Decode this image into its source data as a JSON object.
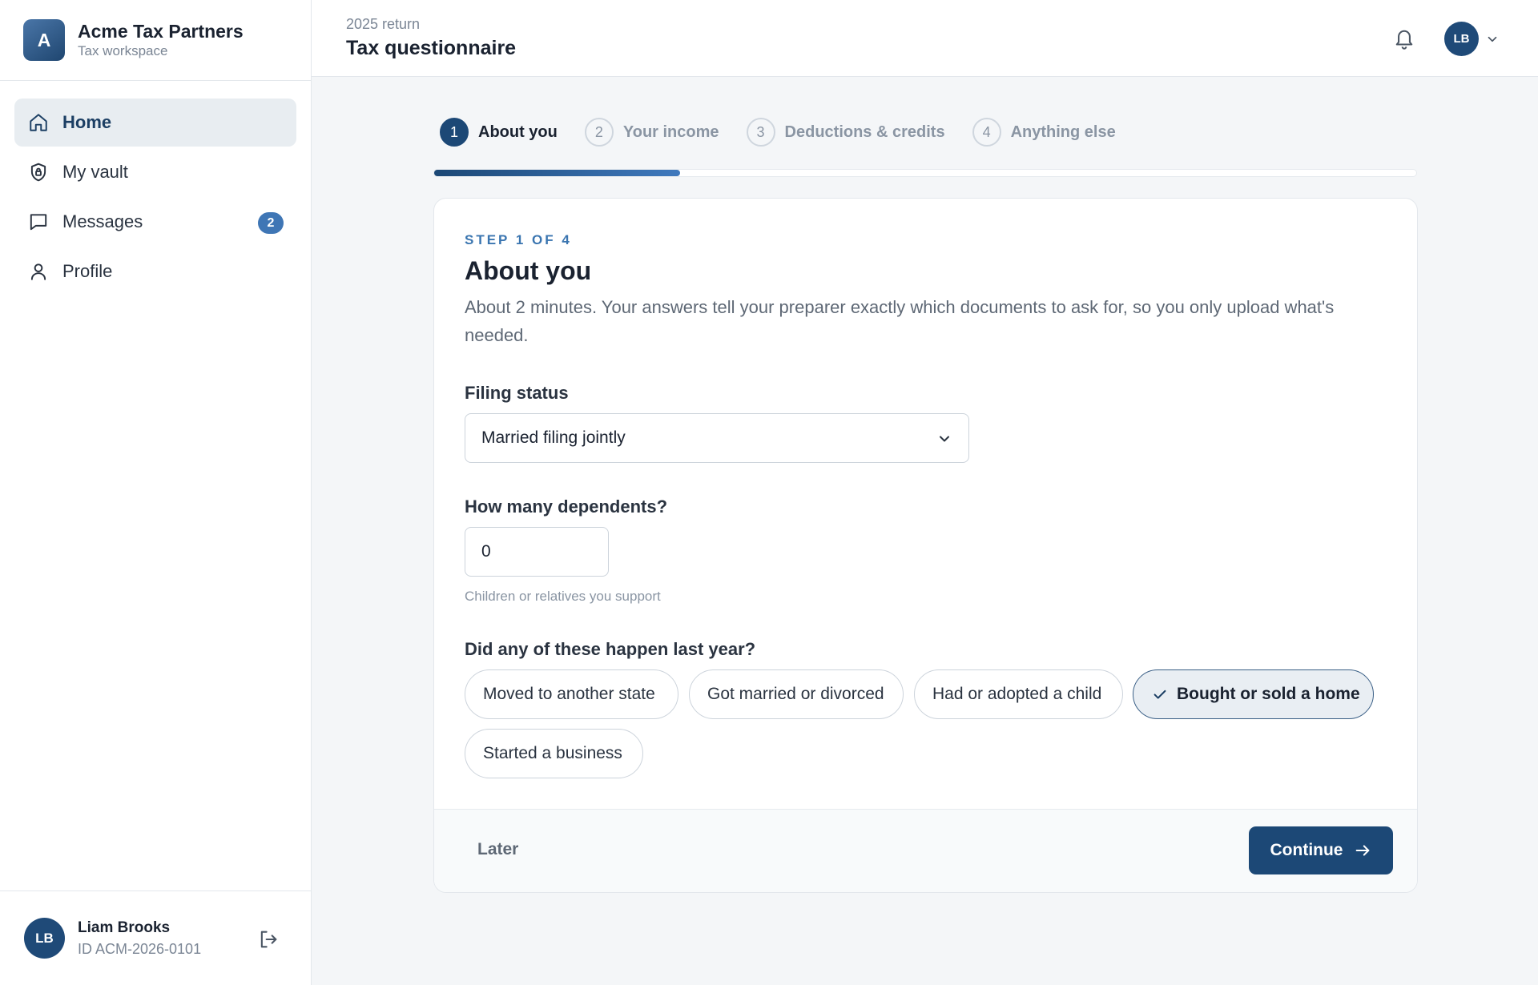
{
  "brand": {
    "logo_letter": "A",
    "name": "Acme Tax Partners",
    "subtitle": "Tax workspace"
  },
  "sidebar": {
    "items": [
      {
        "label": "Home",
        "icon": "home-icon",
        "active": true
      },
      {
        "label": "My vault",
        "icon": "shield-icon"
      },
      {
        "label": "Messages",
        "icon": "chat-icon",
        "badge": "2"
      },
      {
        "label": "Profile",
        "icon": "user-icon"
      }
    ]
  },
  "user": {
    "initials": "LB",
    "name": "Liam Brooks",
    "id": "ID ACM-2026-0101"
  },
  "header": {
    "subtitle": "2025 return",
    "title": "Tax questionnaire",
    "avatar_initials": "LB"
  },
  "stepper": {
    "steps": [
      {
        "number": "1",
        "label": "About you",
        "active": true
      },
      {
        "number": "2",
        "label": "Your income"
      },
      {
        "number": "3",
        "label": "Deductions & credits"
      },
      {
        "number": "4",
        "label": "Anything else"
      }
    ],
    "progress": 0.25
  },
  "form": {
    "eyebrow": "STEP 1 OF 4",
    "title": "About you",
    "description": "About 2 minutes. Your answers tell your preparer exactly which documents to ask for, so you only upload what's needed.",
    "filing_status": {
      "label": "Filing status",
      "value": "Married filing jointly"
    },
    "dependents": {
      "label": "How many dependents?",
      "value": "0",
      "help": "Children or relatives you support"
    },
    "events": {
      "label": "Did any of these happen last year?",
      "options": [
        {
          "label": "Moved to another state",
          "selected": false
        },
        {
          "label": "Got married or divorced",
          "selected": false
        },
        {
          "label": "Had or adopted a child",
          "selected": false
        },
        {
          "label": "Bought or sold a home",
          "selected": true
        },
        {
          "label": "Started a business",
          "selected": false
        }
      ]
    }
  },
  "footer": {
    "later_label": "Later",
    "continue_label": "Continue"
  },
  "colors": {
    "primary": "#1c4876",
    "accent": "#3f76b5",
    "badge": "#3f76b5"
  }
}
